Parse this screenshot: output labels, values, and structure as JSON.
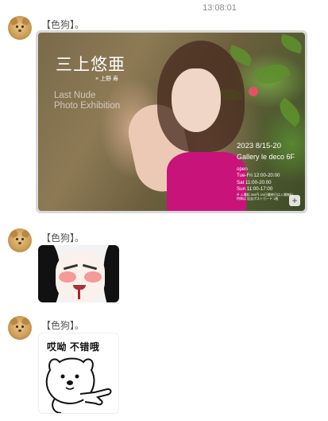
{
  "chat": {
    "timestamp": "13:08:01",
    "messages": [
      {
        "sender": "【色狗】。",
        "type": "image",
        "image": {
          "title": "三上悠亜",
          "subtitle": "× 上野 寿",
          "english_title_line1": "Last Nude",
          "english_title_line2": "Photo Exhibition",
          "date": "2023 8/15-20",
          "venue": "Gallery le deco 6F",
          "hours": [
            "open",
            "Tue-Fri 12:00-20:00",
            "Sat 11:00-20:00",
            "Sun 11:00-17:00"
          ],
          "notes": [
            "※ 入場料 500円 /20日最終日は入場無料",
            "特典は 記念ポストカード 1枚"
          ],
          "expand_icon": "plus-icon"
        }
      },
      {
        "sender": "【色狗】。",
        "type": "sticker",
        "sticker": {
          "kind": "blushing-face"
        }
      },
      {
        "sender": "【色狗】。",
        "type": "sticker",
        "sticker": {
          "kind": "bear-pointing",
          "caption": "哎呦 不错哦"
        }
      }
    ]
  }
}
